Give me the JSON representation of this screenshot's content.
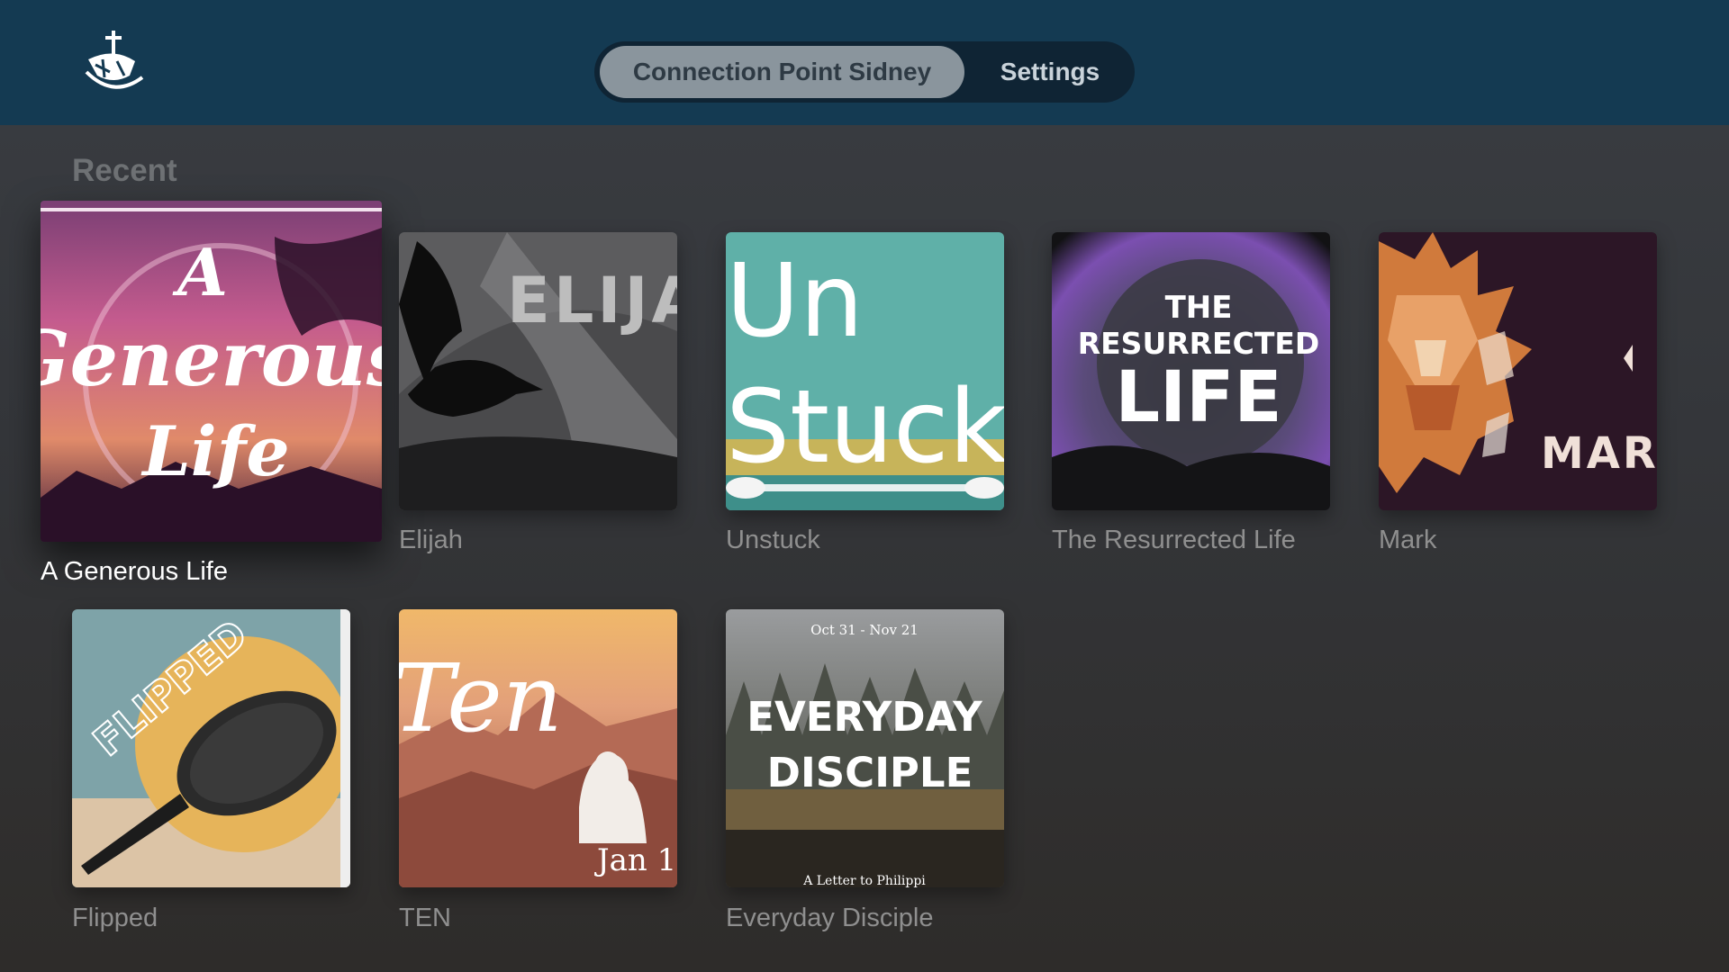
{
  "header": {
    "logo_icon": "church-ship-cross-icon",
    "tabs": [
      {
        "label": "Connection Point Sidney",
        "selected": true
      },
      {
        "label": "Settings",
        "selected": false
      }
    ]
  },
  "section": {
    "title": "Recent"
  },
  "items": [
    {
      "title": "A Generous Life",
      "art": {
        "line1": "A",
        "line2": "Generous",
        "line3": "Life"
      }
    },
    {
      "title": "Elijah",
      "art": {
        "text": "ELIJA"
      }
    },
    {
      "title": "Unstuck",
      "art": {
        "line1": "Un",
        "line2": "Stuck"
      }
    },
    {
      "title": "The Resurrected Life",
      "art": {
        "line1": "THE",
        "line2": "RESURRECTED",
        "line3": "LIFE"
      }
    },
    {
      "title": "Mark",
      "art": {
        "text": "MAR"
      }
    },
    {
      "title": "Flipped",
      "art": {
        "text": "FLIPPED"
      }
    },
    {
      "title": "TEN",
      "art": {
        "line1": "Ten",
        "line2": "Jan 1"
      }
    },
    {
      "title": "Everyday Disciple",
      "art": {
        "date": "Oct 31 - Nov 21",
        "line1": "EVERYDAY",
        "line2": "DISCIPLE",
        "line3": "A Letter to Philippi"
      }
    }
  ],
  "colors": {
    "topbar": "#143a52",
    "tab_selected": "#8a959d",
    "background": "#36383c"
  }
}
